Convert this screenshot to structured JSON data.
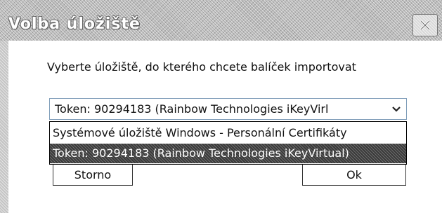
{
  "window": {
    "title": "Volba úložiště",
    "close_icon": "close-icon"
  },
  "prompt": "Vyberte úložiště, do kterého chcete balíček importovat",
  "store_select": {
    "selected": "Token: 90294183 (Rainbow Technologies iKeyVirl",
    "options": [
      "Systémové úložiště Windows - Personální Certifikáty",
      "Token: 90294183 (Rainbow Technologies iKeyVirtual)"
    ],
    "highlighted_index": 1
  },
  "buttons": {
    "cancel": "Storno",
    "ok": "Ok"
  },
  "colors": {
    "combo_border": "#7f9db9",
    "highlight": "#3a3a3a"
  }
}
